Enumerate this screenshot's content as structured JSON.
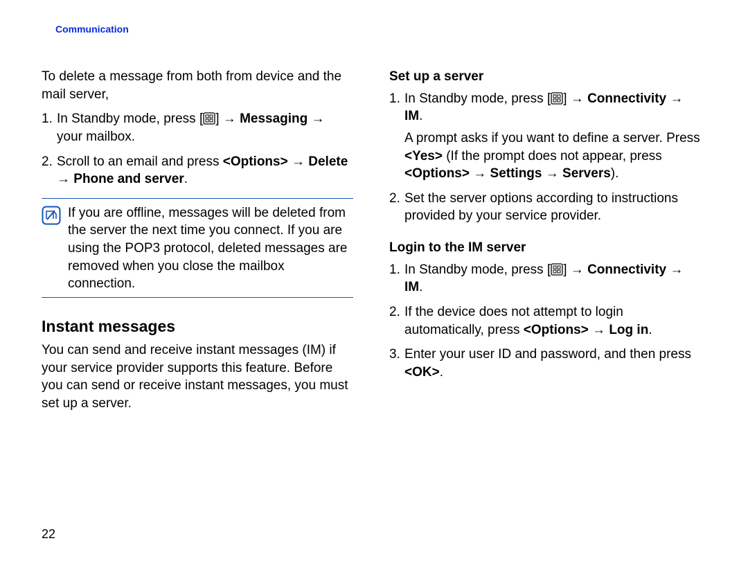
{
  "header": "Communication",
  "pageNumber": "22",
  "left": {
    "intro": "To delete a message from both from device and the mail server,",
    "step1_a": "In Standby mode, press [",
    "step1_b": "] ",
    "step1_c": "Messaging",
    "step1_d": " → your mailbox.",
    "step2_a": "Scroll to an email and press ",
    "step2_b": "<Options>",
    "step2_c": " → ",
    "step2_d": "Delete",
    "step2_e": " → ",
    "step2_f": "Phone and server",
    "note": "If you are offline, messages will be deleted from the server the next time you connect. If you are using the POP3 protocol, deleted messages are removed when you close the mailbox connection.",
    "imHeading": "Instant messages",
    "imBody": "You can send and receive instant messages (IM) if your service provider supports this feature. Before you can send or receive instant messages, you must set up a server."
  },
  "right": {
    "setupHeading": "Set up a server",
    "s1_a": "In Standby mode, press [",
    "s1_b": "] ",
    "s1_c": "Connectivity",
    "s1_d": " → ",
    "s1_e": "IM",
    "promptA": "A prompt asks if you want to define a server. Press ",
    "promptB": "<Yes>",
    "promptC": " (If the prompt does not appear, press ",
    "promptD": "<Options>",
    "promptE": " → ",
    "promptF": "Settings",
    "promptG": " → ",
    "promptH": "Servers",
    "promptI": ").",
    "s2": "Set the server options according to instructions provided by your service provider.",
    "loginHeading": "Login to the IM server",
    "l1_a": "In Standby mode, press [",
    "l1_b": "] ",
    "l1_c": "Connectivity",
    "l1_d": " → ",
    "l1_e": "IM",
    "l2_a": "If the device does not attempt to login automatically, press ",
    "l2_b": "<Options>",
    "l2_c": " → ",
    "l2_d": "Log in",
    "l3_a": "Enter your user ID and password, and then press ",
    "l3_b": "<OK>"
  }
}
